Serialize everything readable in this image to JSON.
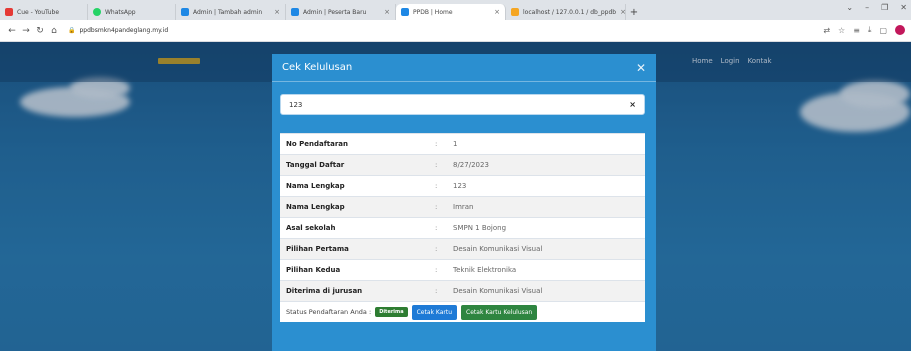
{
  "browser": {
    "tabs": [
      {
        "title": "Cue - YouTube",
        "color": "#e53935"
      },
      {
        "title": "WhatsApp",
        "color": "#25d366"
      },
      {
        "title": "Admin | Tambah admin",
        "color": "#1e88e5"
      },
      {
        "title": "Admin | Peserta Baru",
        "color": "#1e88e5"
      },
      {
        "title": "PPDB | Home",
        "color": "#1e88e5"
      },
      {
        "title": "localhost / 127.0.0.1 / db_ppdb",
        "color": "#f5a623"
      }
    ],
    "url": "ppdbsmkn4pandeglang.my.id"
  },
  "site": {
    "menu": [
      "Home",
      "Login",
      "Kontak"
    ]
  },
  "modal": {
    "title": "Cek Kelulusan",
    "search_value": "123",
    "rows": [
      {
        "label": "No Pendaftaran",
        "value": "1"
      },
      {
        "label": "Tanggal Daftar",
        "value": "8/27/2023"
      },
      {
        "label": "Nama Lengkap",
        "value": "123"
      },
      {
        "label": "Nama Lengkap",
        "value": "Imran"
      },
      {
        "label": "Asal sekolah",
        "value": "SMPN 1 Bojong"
      },
      {
        "label": "Pilihan Pertama",
        "value": "Desain Komunikasi Visual"
      },
      {
        "label": "Pilihan Kedua",
        "value": "Teknik Elektronika"
      },
      {
        "label": "Diterima di jurusan",
        "value": "Desain Komunikasi Visual"
      }
    ],
    "status_label": "Status Pendaftaran Anda :",
    "status_badge": "Diterima",
    "btn_cetak_kartu": "Cetak Kartu",
    "btn_cetak_kelulusan": "Cetak Kartu Kelulusan"
  },
  "colors": {
    "modal_bg": "#2b8fd0",
    "badge_green": "#2e7d32",
    "btn_blue": "#1e7ad6",
    "btn_green": "#2e8540"
  }
}
